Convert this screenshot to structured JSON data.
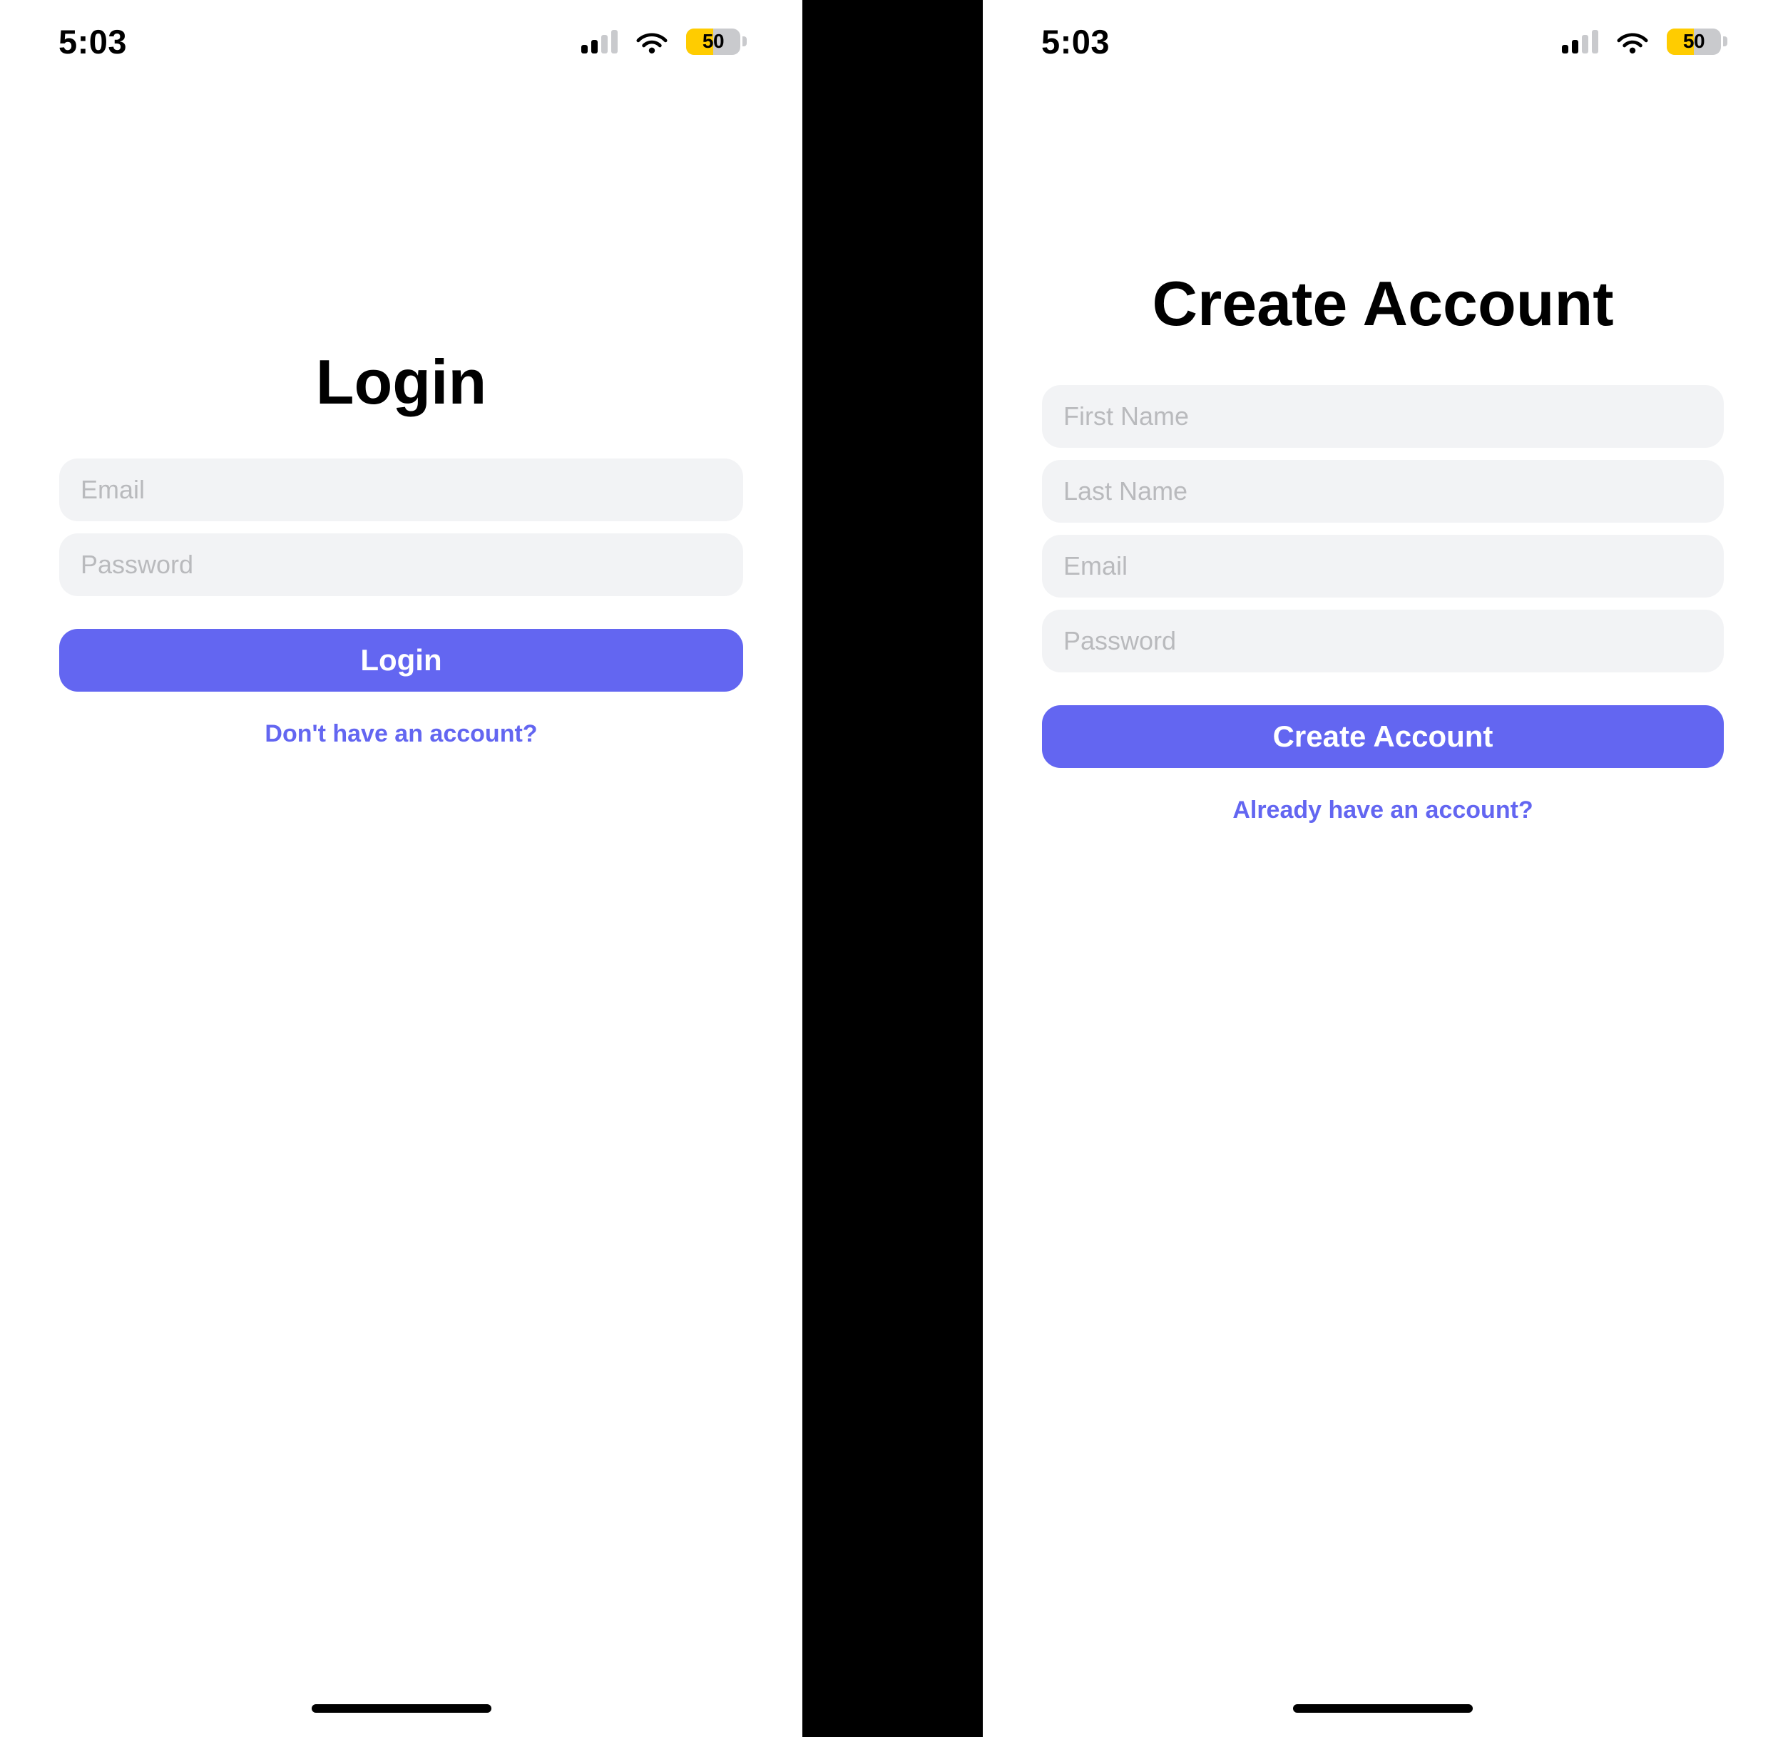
{
  "theme": {
    "accent": "#6366f1",
    "field_bg": "#f2f3f5",
    "placeholder": "#b9babd",
    "battery_fill": "#ffcc00",
    "divider": "#000000",
    "page_bg": "#ffffff",
    "text": "#000000"
  },
  "screens": [
    {
      "id": "login",
      "status_bar": {
        "time": "5:03",
        "signal_icon": "cellular-signal-icon",
        "wifi_icon": "wifi-icon",
        "battery": {
          "icon": "battery-icon",
          "level": "50"
        }
      },
      "title": "Login",
      "fields": [
        {
          "name": "email",
          "placeholder": "Email",
          "value": ""
        },
        {
          "name": "password",
          "placeholder": "Password",
          "value": ""
        }
      ],
      "primary_button": "Login",
      "alt_link": "Don't have an account?"
    },
    {
      "id": "create-account",
      "status_bar": {
        "time": "5:03",
        "signal_icon": "cellular-signal-icon",
        "wifi_icon": "wifi-icon",
        "battery": {
          "icon": "battery-icon",
          "level": "50"
        }
      },
      "title": "Create Account",
      "fields": [
        {
          "name": "first-name",
          "placeholder": "First Name",
          "value": ""
        },
        {
          "name": "last-name",
          "placeholder": "Last Name",
          "value": ""
        },
        {
          "name": "email",
          "placeholder": "Email",
          "value": ""
        },
        {
          "name": "password",
          "placeholder": "Password",
          "value": ""
        }
      ],
      "primary_button": "Create Account",
      "alt_link": "Already have an account?"
    }
  ]
}
